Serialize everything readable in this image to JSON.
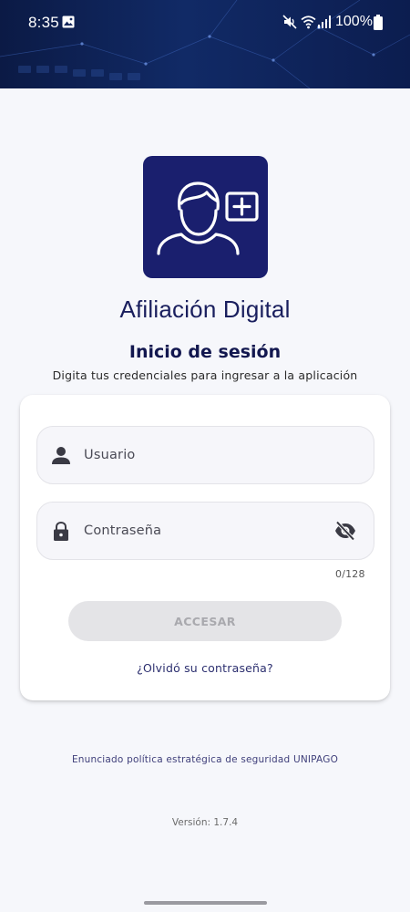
{
  "status_bar": {
    "time": "8:35",
    "battery": "100%",
    "icons": [
      "gallery-icon",
      "mute-icon",
      "wifi-icon",
      "signal-icon",
      "battery-icon"
    ]
  },
  "app": {
    "title": "Afiliación Digital"
  },
  "login": {
    "title": "Inicio de sesión",
    "subtitle": "Digita tus credenciales para ingresar a la aplicación",
    "username_placeholder": "Usuario",
    "password_placeholder": "Contraseña",
    "password_counter": "0/128",
    "submit_label": "ACCESAR",
    "forgot_label": "¿Olvidó su contraseña?"
  },
  "footer": {
    "policy_link": "Enunciado política estratégica de seguridad UNIPAGO",
    "version": "Versión: 1.7.4"
  },
  "colors": {
    "brand": "#1a1f6e",
    "title_text": "#12174f",
    "button_disabled_bg": "#e4e4e7",
    "button_disabled_text": "#a9a9ae",
    "page_background": "#f6f7fb"
  }
}
